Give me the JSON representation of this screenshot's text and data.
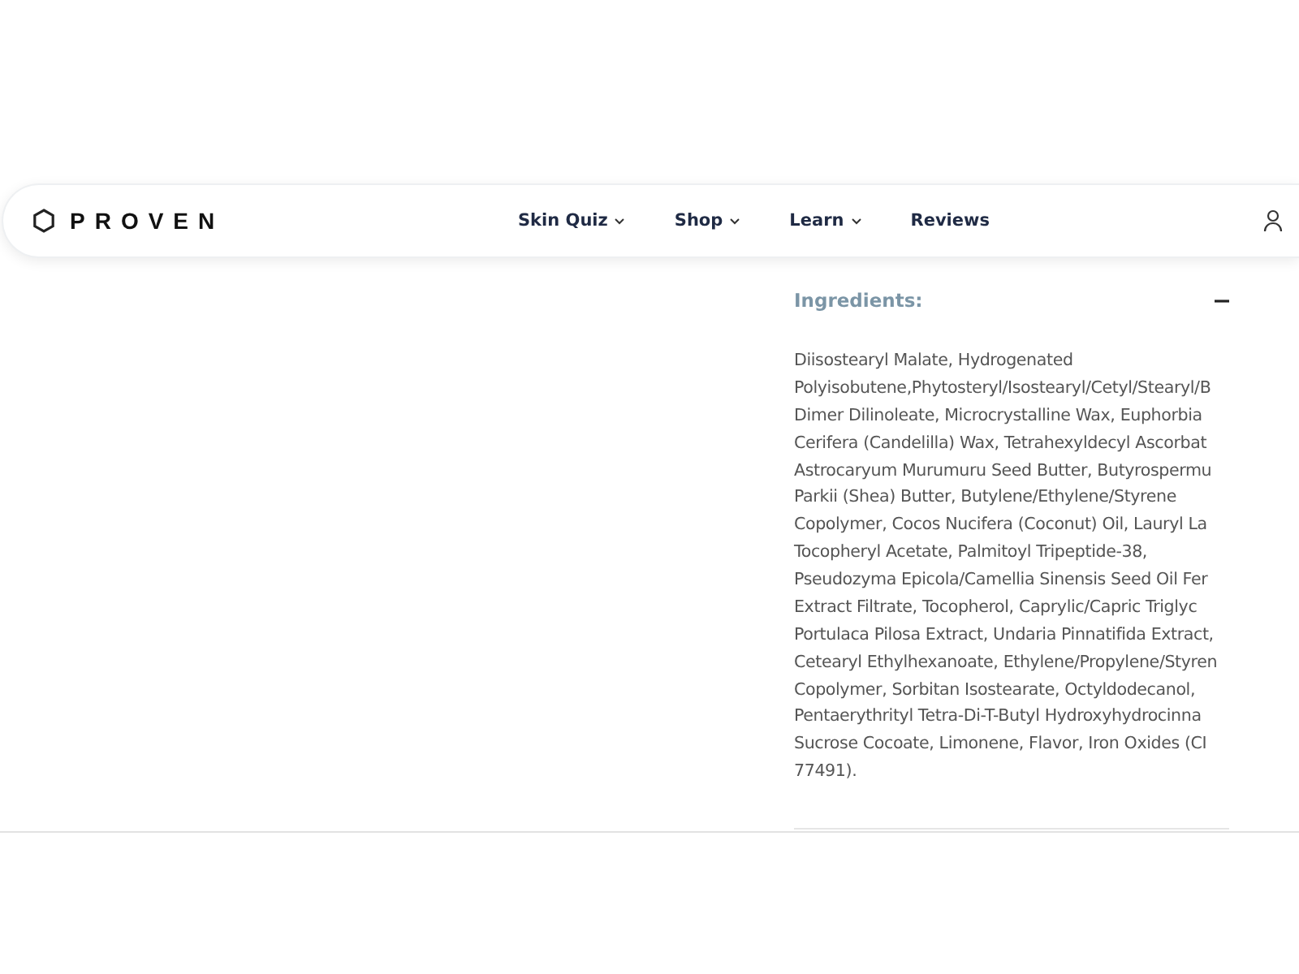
{
  "header": {
    "logo": "PROVEN",
    "nav": [
      {
        "label": "Skin Quiz",
        "dropdown": true
      },
      {
        "label": "Shop",
        "dropdown": true
      },
      {
        "label": "Learn",
        "dropdown": true
      },
      {
        "label": "Reviews",
        "dropdown": false
      }
    ]
  },
  "ingredients": {
    "title": "Ingredients:",
    "expanded": true,
    "lines": [
      "Diisostearyl Malate, Hydrogenated",
      "Polyisobutene,Phytosteryl/Isostearyl/Cetyl/Stearyl/B",
      "Dimer Dilinoleate, Microcrystalline Wax, Euphorbia",
      "Cerifera (Candelilla) Wax, Tetrahexyldecyl Ascorbat",
      "Astrocaryum Murumuru Seed Butter, Butyrospermu",
      "Parkii (Shea) Butter, Butylene/Ethylene/Styrene",
      "Copolymer, Cocos Nucifera (Coconut) Oil, Lauryl La",
      "Tocopheryl Acetate, Palmitoyl Tripeptide-38,",
      "Pseudozyma Epicola/Camellia Sinensis Seed Oil Fer",
      "Extract Filtrate, Tocopherol, Caprylic/Capric Triglyc",
      "Portulaca Pilosa Extract, Undaria Pinnatifida Extract,",
      "Cetearyl Ethylhexanoate, Ethylene/Propylene/Styren",
      "Copolymer, Sorbitan Isostearate, Octyldodecanol,",
      "Pentaerythrityl Tetra-Di-T-Butyl Hydroxyhydrocinna",
      "Sucrose Cocoate, Limonene, Flavor, Iron Oxides (CI",
      "77491)."
    ]
  }
}
